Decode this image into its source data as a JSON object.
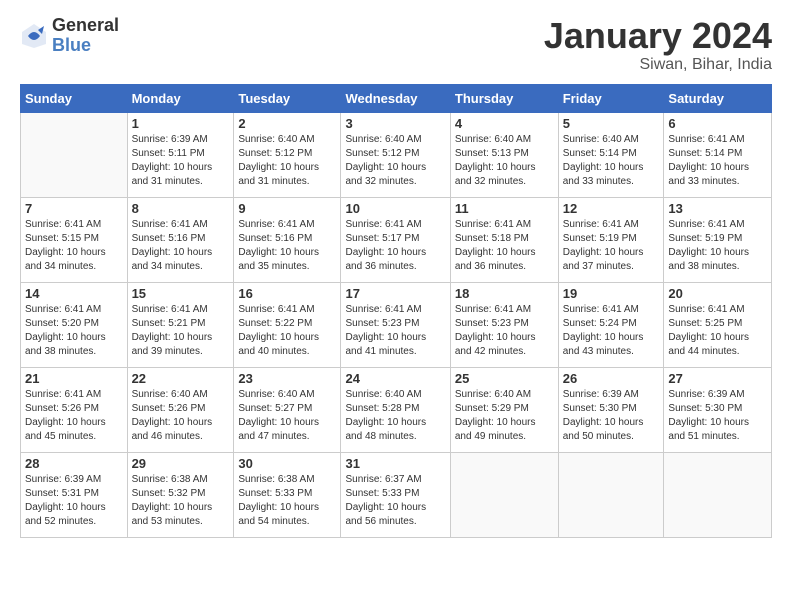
{
  "logo": {
    "general": "General",
    "blue": "Blue"
  },
  "header": {
    "title": "January 2024",
    "location": "Siwan, Bihar, India"
  },
  "days_of_week": [
    "Sunday",
    "Monday",
    "Tuesday",
    "Wednesday",
    "Thursday",
    "Friday",
    "Saturday"
  ],
  "weeks": [
    [
      {
        "day": "",
        "content": ""
      },
      {
        "day": "1",
        "content": "Sunrise: 6:39 AM\nSunset: 5:11 PM\nDaylight: 10 hours\nand 31 minutes."
      },
      {
        "day": "2",
        "content": "Sunrise: 6:40 AM\nSunset: 5:12 PM\nDaylight: 10 hours\nand 31 minutes."
      },
      {
        "day": "3",
        "content": "Sunrise: 6:40 AM\nSunset: 5:12 PM\nDaylight: 10 hours\nand 32 minutes."
      },
      {
        "day": "4",
        "content": "Sunrise: 6:40 AM\nSunset: 5:13 PM\nDaylight: 10 hours\nand 32 minutes."
      },
      {
        "day": "5",
        "content": "Sunrise: 6:40 AM\nSunset: 5:14 PM\nDaylight: 10 hours\nand 33 minutes."
      },
      {
        "day": "6",
        "content": "Sunrise: 6:41 AM\nSunset: 5:14 PM\nDaylight: 10 hours\nand 33 minutes."
      }
    ],
    [
      {
        "day": "7",
        "content": "Sunrise: 6:41 AM\nSunset: 5:15 PM\nDaylight: 10 hours\nand 34 minutes."
      },
      {
        "day": "8",
        "content": "Sunrise: 6:41 AM\nSunset: 5:16 PM\nDaylight: 10 hours\nand 34 minutes."
      },
      {
        "day": "9",
        "content": "Sunrise: 6:41 AM\nSunset: 5:16 PM\nDaylight: 10 hours\nand 35 minutes."
      },
      {
        "day": "10",
        "content": "Sunrise: 6:41 AM\nSunset: 5:17 PM\nDaylight: 10 hours\nand 36 minutes."
      },
      {
        "day": "11",
        "content": "Sunrise: 6:41 AM\nSunset: 5:18 PM\nDaylight: 10 hours\nand 36 minutes."
      },
      {
        "day": "12",
        "content": "Sunrise: 6:41 AM\nSunset: 5:19 PM\nDaylight: 10 hours\nand 37 minutes."
      },
      {
        "day": "13",
        "content": "Sunrise: 6:41 AM\nSunset: 5:19 PM\nDaylight: 10 hours\nand 38 minutes."
      }
    ],
    [
      {
        "day": "14",
        "content": "Sunrise: 6:41 AM\nSunset: 5:20 PM\nDaylight: 10 hours\nand 38 minutes."
      },
      {
        "day": "15",
        "content": "Sunrise: 6:41 AM\nSunset: 5:21 PM\nDaylight: 10 hours\nand 39 minutes."
      },
      {
        "day": "16",
        "content": "Sunrise: 6:41 AM\nSunset: 5:22 PM\nDaylight: 10 hours\nand 40 minutes."
      },
      {
        "day": "17",
        "content": "Sunrise: 6:41 AM\nSunset: 5:23 PM\nDaylight: 10 hours\nand 41 minutes."
      },
      {
        "day": "18",
        "content": "Sunrise: 6:41 AM\nSunset: 5:23 PM\nDaylight: 10 hours\nand 42 minutes."
      },
      {
        "day": "19",
        "content": "Sunrise: 6:41 AM\nSunset: 5:24 PM\nDaylight: 10 hours\nand 43 minutes."
      },
      {
        "day": "20",
        "content": "Sunrise: 6:41 AM\nSunset: 5:25 PM\nDaylight: 10 hours\nand 44 minutes."
      }
    ],
    [
      {
        "day": "21",
        "content": "Sunrise: 6:41 AM\nSunset: 5:26 PM\nDaylight: 10 hours\nand 45 minutes."
      },
      {
        "day": "22",
        "content": "Sunrise: 6:40 AM\nSunset: 5:26 PM\nDaylight: 10 hours\nand 46 minutes."
      },
      {
        "day": "23",
        "content": "Sunrise: 6:40 AM\nSunset: 5:27 PM\nDaylight: 10 hours\nand 47 minutes."
      },
      {
        "day": "24",
        "content": "Sunrise: 6:40 AM\nSunset: 5:28 PM\nDaylight: 10 hours\nand 48 minutes."
      },
      {
        "day": "25",
        "content": "Sunrise: 6:40 AM\nSunset: 5:29 PM\nDaylight: 10 hours\nand 49 minutes."
      },
      {
        "day": "26",
        "content": "Sunrise: 6:39 AM\nSunset: 5:30 PM\nDaylight: 10 hours\nand 50 minutes."
      },
      {
        "day": "27",
        "content": "Sunrise: 6:39 AM\nSunset: 5:30 PM\nDaylight: 10 hours\nand 51 minutes."
      }
    ],
    [
      {
        "day": "28",
        "content": "Sunrise: 6:39 AM\nSunset: 5:31 PM\nDaylight: 10 hours\nand 52 minutes."
      },
      {
        "day": "29",
        "content": "Sunrise: 6:38 AM\nSunset: 5:32 PM\nDaylight: 10 hours\nand 53 minutes."
      },
      {
        "day": "30",
        "content": "Sunrise: 6:38 AM\nSunset: 5:33 PM\nDaylight: 10 hours\nand 54 minutes."
      },
      {
        "day": "31",
        "content": "Sunrise: 6:37 AM\nSunset: 5:33 PM\nDaylight: 10 hours\nand 56 minutes."
      },
      {
        "day": "",
        "content": ""
      },
      {
        "day": "",
        "content": ""
      },
      {
        "day": "",
        "content": ""
      }
    ]
  ]
}
